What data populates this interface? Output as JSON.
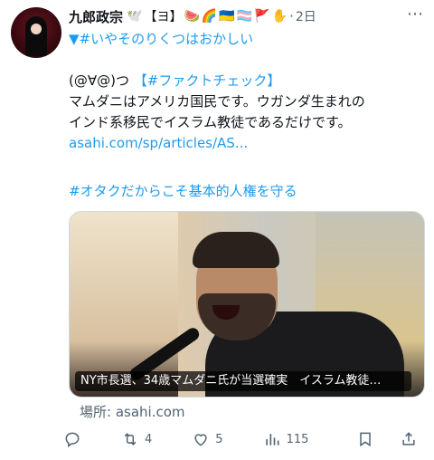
{
  "author": {
    "name": "九郎政宗",
    "badges": [
      "🕊️",
      "【ヨ】",
      "🍉",
      "🌈",
      "🇺🇦",
      "🏳️‍⚧️",
      "🚩",
      "✋"
    ],
    "time": "2日"
  },
  "post": {
    "hashtag1": "▼#いやそのりくつはおかしい",
    "line1_prefix": "(@∀@)つ",
    "line1_tag": "【#ファクトチェック】",
    "line2": "マムダニはアメリカ国民です。ウガンダ生まれの",
    "line3": "インド系移民でイスラム教徒であるだけです。",
    "link": "asahi.com/sp/articles/AS...",
    "hashtag2": "#オタクだからこそ基本的人権を守る"
  },
  "card": {
    "caption": "NY市長選、34歳マムダニ氏が当選確実　イスラム教徒…",
    "source": "場所: asahi.com"
  },
  "actions": {
    "reposts": "4",
    "likes": "5",
    "views": "115"
  }
}
